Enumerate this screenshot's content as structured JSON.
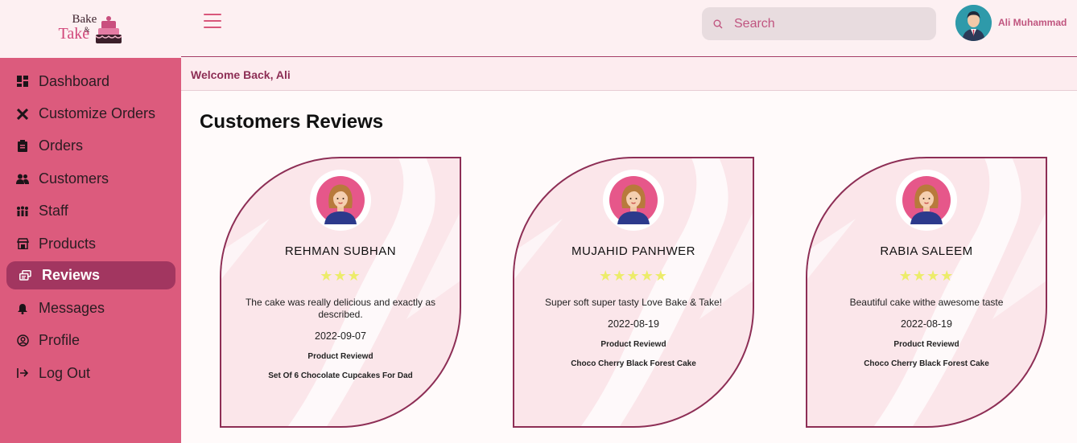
{
  "brand": {
    "line1": "Bake",
    "amp": "&",
    "line2": "Take"
  },
  "sidebar": {
    "items": [
      {
        "label": "Dashboard",
        "icon": "dashboard-icon"
      },
      {
        "label": "Customize Orders",
        "icon": "tools-icon"
      },
      {
        "label": "Orders",
        "icon": "clipboard-icon"
      },
      {
        "label": "Customers",
        "icon": "users-icon"
      },
      {
        "label": "Staff",
        "icon": "staff-icon"
      },
      {
        "label": "Products",
        "icon": "store-icon"
      },
      {
        "label": "Reviews",
        "icon": "reviews-icon",
        "active": true
      },
      {
        "label": "Messages",
        "icon": "bell-icon"
      },
      {
        "label": "Profile",
        "icon": "profile-icon"
      },
      {
        "label": "Log Out",
        "icon": "logout-icon"
      }
    ]
  },
  "header": {
    "search_placeholder": "Search",
    "user_name": "Ali Muhammad"
  },
  "welcome": "Welcome Back, Ali",
  "page_title": "Customers Reviews",
  "reviews": [
    {
      "name": "REHMAN SUBHAN",
      "stars": "★★★",
      "rating": 3,
      "text": "The cake was really delicious and exactly as described.",
      "date": "2022-09-07",
      "product_label": "Product Reviewd",
      "product": "Set Of 6 Chocolate Cupcakes For Dad"
    },
    {
      "name": "MUJAHID PANHWER",
      "stars": "★★★★★",
      "rating": 5,
      "text": "Super soft super tasty Love Bake & Take!",
      "date": "2022-08-19",
      "product_label": "Product Reviewd",
      "product": "Choco Cherry Black Forest Cake"
    },
    {
      "name": "RABIA SALEEM",
      "stars": "★★★★",
      "rating": 4,
      "text": "Beautiful cake withe awesome taste",
      "date": "2022-08-19",
      "product_label": "Product Reviewd",
      "product": "Choco Cherry Black Forest Cake"
    }
  ],
  "colors": {
    "sidebar": "#dc5b7d",
    "active": "#a23660",
    "accent": "#8d2e55",
    "star": "#ecec6a"
  }
}
